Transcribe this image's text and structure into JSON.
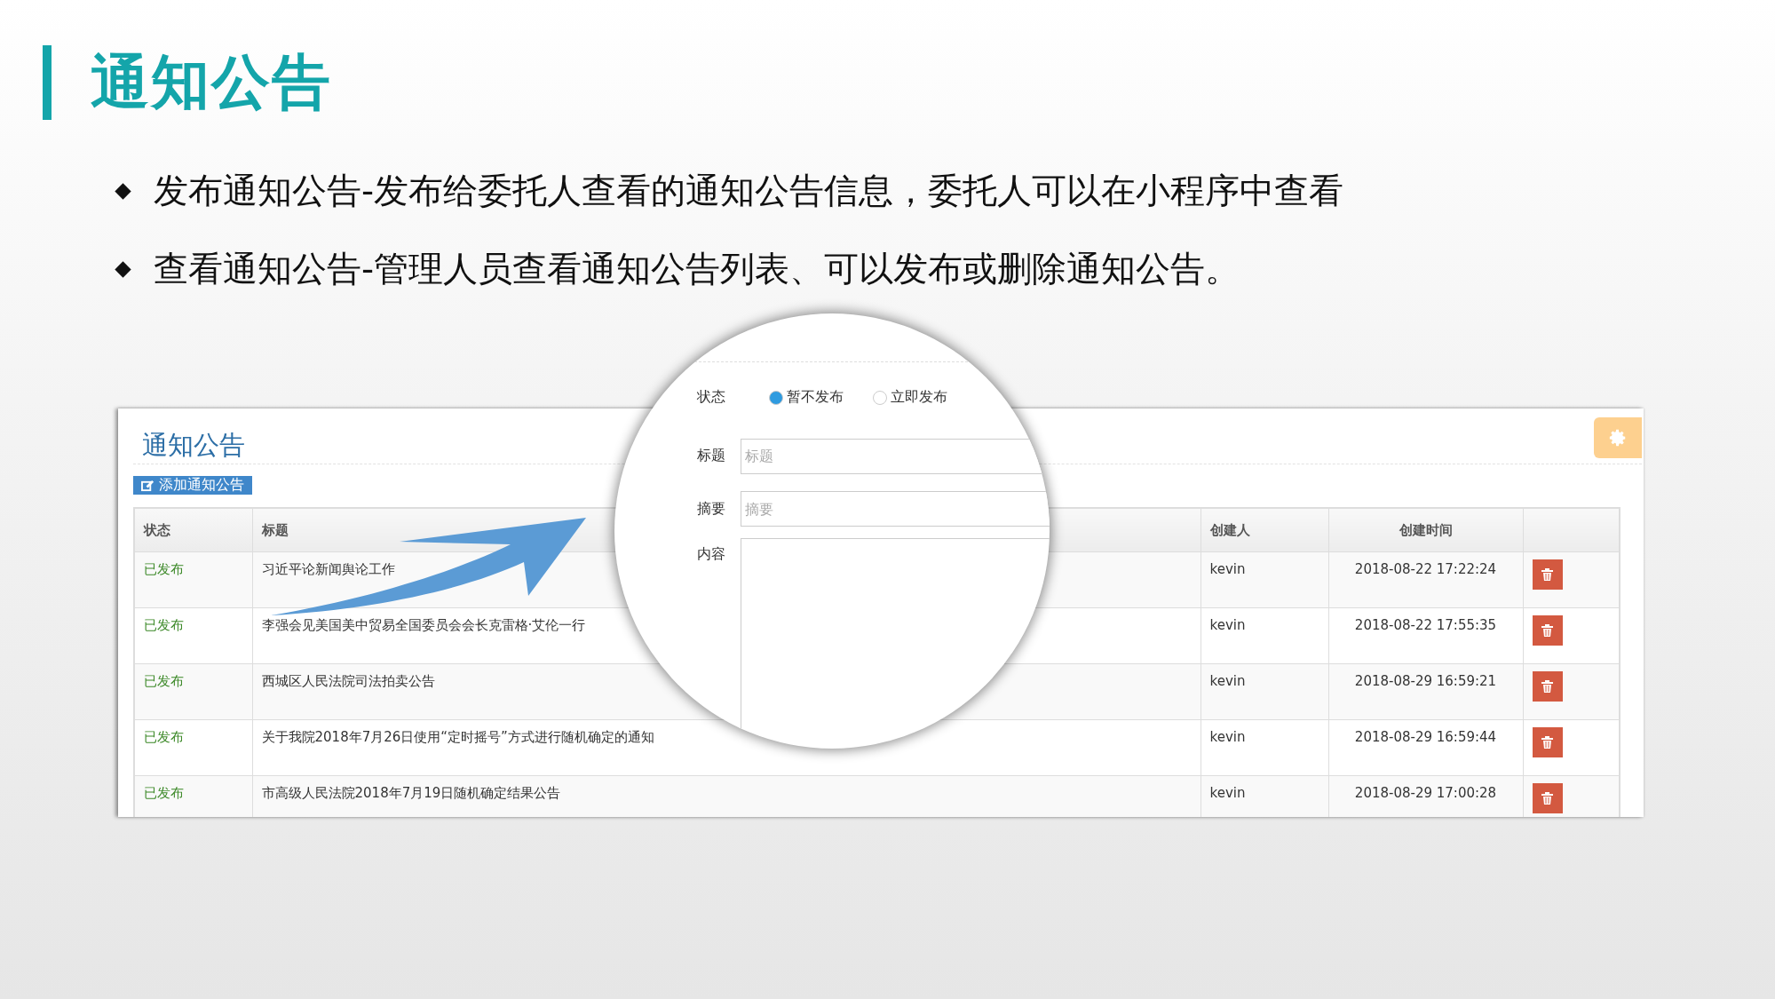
{
  "slide_title": "通知公告",
  "bullets": [
    "发布通知公告-发布给委托人查看的通知公告信息，委托人可以在小程序中查看",
    "查看通知公告-管理人员查看通知公告列表、可以发布或删除通知公告。"
  ],
  "panel": {
    "title": "通知公告",
    "add_button": "添加通知公告",
    "table": {
      "columns": [
        "状态",
        "标题",
        "创建人",
        "创建时间"
      ],
      "rows": [
        {
          "status": "已发布",
          "title": "习近平论新闻舆论工作",
          "creator": "kevin",
          "created": "2018-08-22 17:22:24"
        },
        {
          "status": "已发布",
          "title": "李强会见美国美中贸易全国委员会会长克雷格·艾伦一行",
          "creator": "kevin",
          "created": "2018-08-22 17:55:35"
        },
        {
          "status": "已发布",
          "title": "西城区人民法院司法拍卖公告",
          "creator": "kevin",
          "created": "2018-08-29 16:59:21"
        },
        {
          "status": "已发布",
          "title": "关于我院2018年7月26日使用“定时摇号”方式进行随机确定的通知",
          "creator": "kevin",
          "created": "2018-08-29 16:59:44"
        },
        {
          "status": "已发布",
          "title": "市高级人民法院2018年7月19日随机确定结果公告",
          "creator": "kevin",
          "created": "2018-08-29 17:00:28"
        }
      ]
    }
  },
  "magnifier": {
    "status_label": "状态",
    "options": [
      {
        "label": "暂不发布",
        "selected": true
      },
      {
        "label": "立即发布",
        "selected": false
      }
    ],
    "title_label": "标题",
    "title_placeholder": "标题",
    "summary_label": "摘要",
    "summary_placeholder": "摘要",
    "content_label": "内容"
  }
}
